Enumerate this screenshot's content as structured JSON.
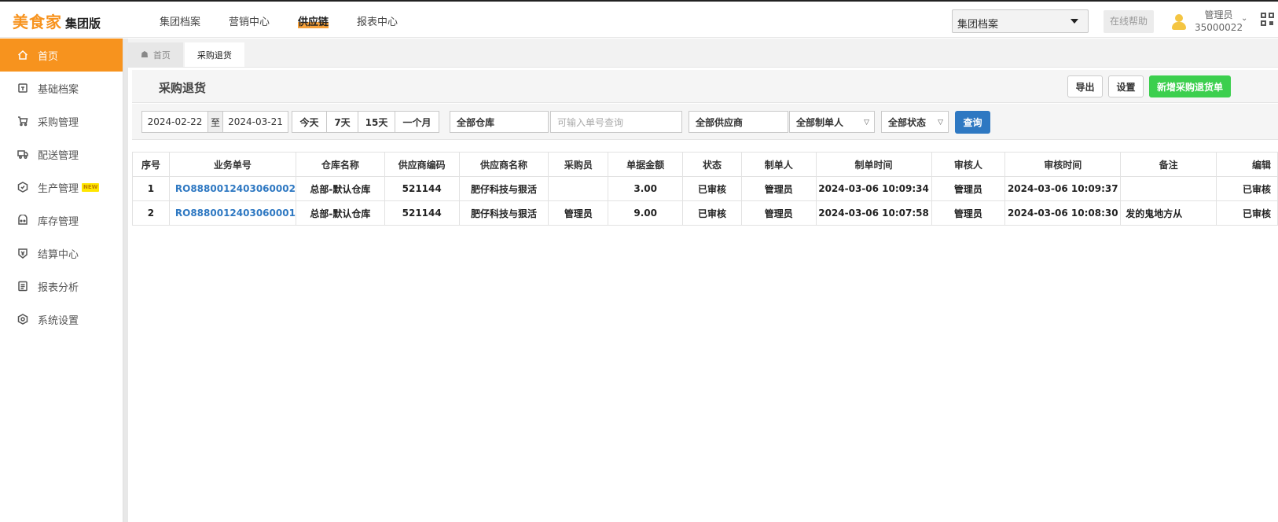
{
  "header": {
    "logo_main": "美食家",
    "logo_sub": "集团版",
    "nav": [
      "集团档案",
      "营销中心",
      "供应链",
      "报表中心"
    ],
    "active_nav": "供应链",
    "group_select_value": "集团档案",
    "help_label": "在线帮助",
    "user_role": "管理员",
    "user_id": "35000022"
  },
  "sidebar": {
    "items": [
      {
        "label": "首页",
        "icon": "home-icon",
        "active": true
      },
      {
        "label": "基础档案",
        "icon": "archive-icon"
      },
      {
        "label": "采购管理",
        "icon": "cart-icon"
      },
      {
        "label": "配送管理",
        "icon": "truck-icon"
      },
      {
        "label": "生产管理",
        "icon": "production-icon",
        "badge": "NEW"
      },
      {
        "label": "库存管理",
        "icon": "inventory-icon"
      },
      {
        "label": "结算中心",
        "icon": "settlement-icon"
      },
      {
        "label": "报表分析",
        "icon": "report-icon"
      },
      {
        "label": "系统设置",
        "icon": "settings-icon"
      }
    ]
  },
  "tabs": [
    {
      "label": "首页",
      "icon": "home-icon"
    },
    {
      "label": "采购退货",
      "active": true
    }
  ],
  "page": {
    "title": "采购退货",
    "export_label": "导出",
    "settings_label": "设置",
    "new_label": "新增采购退货单"
  },
  "filters": {
    "date_start": "2024-02-22",
    "date_sep": "至",
    "date_end": "2024-03-21",
    "quick_ranges": [
      "今天",
      "7天",
      "15天",
      "一个月"
    ],
    "warehouse": "全部仓库",
    "order_no_placeholder": "可输入单号查询",
    "supplier": "全部供应商",
    "creator": "全部制单人",
    "status": "全部状态",
    "query_label": "查询"
  },
  "table": {
    "columns": [
      "序号",
      "业务单号",
      "仓库名称",
      "供应商编码",
      "供应商名称",
      "采购员",
      "单据金额",
      "状态",
      "制单人",
      "制单时间",
      "审核人",
      "审核时间",
      "备注",
      "编辑"
    ],
    "rows": [
      [
        "1",
        "RO8880012403060002",
        "总部-默认仓库",
        "521144",
        "肥仔科技与狠活",
        "",
        "3.00",
        "已审核",
        "管理员",
        "2024-03-06 10:09:34",
        "管理员",
        "2024-03-06 10:09:37",
        "",
        "已审核"
      ],
      [
        "2",
        "RO8880012403060001",
        "总部-默认仓库",
        "521144",
        "肥仔科技与狠活",
        "管理员",
        "9.00",
        "已审核",
        "管理员",
        "2024-03-06 10:07:58",
        "管理员",
        "2024-03-06 10:08:30",
        "发的鬼地方从",
        "已审核"
      ]
    ]
  },
  "colors": {
    "accent_orange": "#f7931e",
    "link_blue": "#2e78c2",
    "new_button_green": "#3ccf4e",
    "query_button_blue": "#2e78c2"
  }
}
